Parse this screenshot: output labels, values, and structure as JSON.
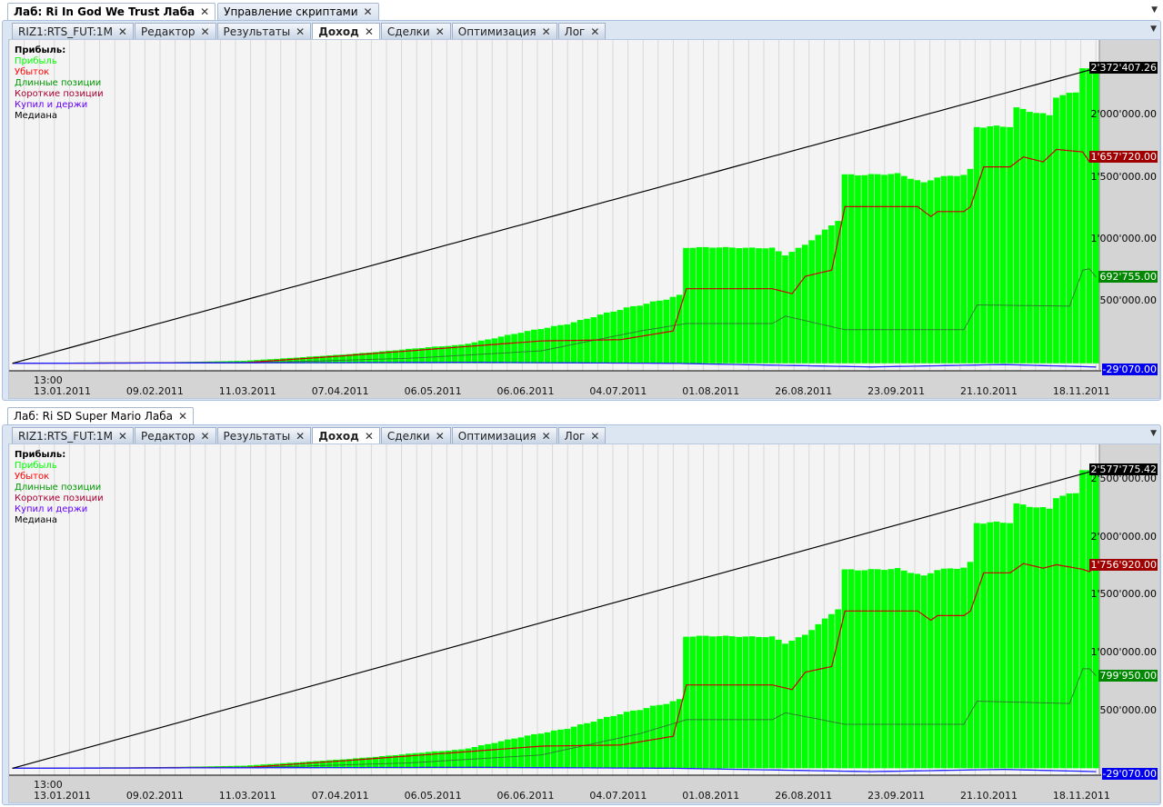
{
  "top_window": {
    "tabs": [
      {
        "label": "Лаб: Ri In God We Trust Лаба",
        "active": true
      },
      {
        "label": "Управление скриптами",
        "active": false
      }
    ]
  },
  "bottom_window": {
    "tabs": [
      {
        "label": "Лаб: Ri SD Super Mario Лаба",
        "active": true
      }
    ]
  },
  "inner_tabs": [
    {
      "label": "RIZ1:RTS_FUT:1M"
    },
    {
      "label": "Редактор"
    },
    {
      "label": "Результаты"
    },
    {
      "label": "Доход",
      "active": true
    },
    {
      "label": "Сделки"
    },
    {
      "label": "Оптимизация"
    },
    {
      "label": "Лог"
    }
  ],
  "legend": {
    "title": "Прибыль:",
    "items": [
      {
        "label": "Прибыль",
        "color": "#00ff00"
      },
      {
        "label": "Убыток",
        "color": "#ff0000"
      },
      {
        "label": "Длинные позиции",
        "color": "#009900"
      },
      {
        "label": "Короткие позиции",
        "color": "#aa0033"
      },
      {
        "label": "Купил и держи",
        "color": "#6600ff"
      },
      {
        "label": "Медиана",
        "color": "#000000"
      }
    ]
  },
  "x_time_label": "13:00",
  "x_dates": [
    "13.01.2011",
    "09.02.2011",
    "11.03.2011",
    "07.04.2011",
    "06.05.2011",
    "06.06.2011",
    "04.07.2011",
    "01.08.2011",
    "26.08.2011",
    "23.09.2011",
    "21.10.2011",
    "18.11.2011"
  ],
  "chart_data": [
    {
      "type": "bar",
      "title": "Ri In God We Trust Лаба — Доход",
      "bars": 165,
      "ylim": [
        -60000,
        2600000
      ],
      "yticks": [
        "500'000.00",
        "1'000'000.00",
        "1'500'000.00",
        "2'000'000.00"
      ],
      "ytick_values": [
        500000,
        1000000,
        1500000,
        2000000
      ],
      "last_labels": {
        "profit": "2'372'407.26",
        "short": "1'657'720.00",
        "long": "692'755.00",
        "buyhold": "-29'070.00"
      },
      "profit": [
        [
          0,
          0
        ],
        [
          20,
          5000
        ],
        [
          35,
          20000
        ],
        [
          50,
          70000
        ],
        [
          68,
          150000
        ],
        [
          84,
          320000
        ],
        [
          101,
          550000
        ],
        [
          102,
          930000
        ],
        [
          115,
          930000
        ],
        [
          117,
          870000
        ],
        [
          120,
          950000
        ],
        [
          125,
          1150000
        ],
        [
          126,
          1520000
        ],
        [
          134,
          1520000
        ],
        [
          138,
          1450000
        ],
        [
          140,
          1500000
        ],
        [
          144,
          1520000
        ],
        [
          145,
          1560000
        ],
        [
          146,
          1900000
        ],
        [
          151,
          1900000
        ],
        [
          152,
          2050000
        ],
        [
          157,
          2000000
        ],
        [
          158,
          2150000
        ],
        [
          161,
          2180000
        ],
        [
          162,
          2370000
        ],
        [
          164,
          2372407
        ]
      ],
      "short": [
        [
          0,
          0
        ],
        [
          35,
          5000
        ],
        [
          50,
          60000
        ],
        [
          65,
          120000
        ],
        [
          80,
          180000
        ],
        [
          92,
          190000
        ],
        [
          100,
          260000
        ],
        [
          102,
          600000
        ],
        [
          115,
          600000
        ],
        [
          118,
          560000
        ],
        [
          120,
          700000
        ],
        [
          124,
          750000
        ],
        [
          126,
          1260000
        ],
        [
          137,
          1260000
        ],
        [
          139,
          1180000
        ],
        [
          140,
          1220000
        ],
        [
          144,
          1220000
        ],
        [
          145,
          1260000
        ],
        [
          147,
          1580000
        ],
        [
          151,
          1580000
        ],
        [
          153,
          1660000
        ],
        [
          156,
          1620000
        ],
        [
          158,
          1720000
        ],
        [
          162,
          1700000
        ],
        [
          163,
          1620000
        ],
        [
          164,
          1657720
        ]
      ],
      "long": [
        [
          0,
          0
        ],
        [
          40,
          10000
        ],
        [
          60,
          40000
        ],
        [
          80,
          100000
        ],
        [
          95,
          260000
        ],
        [
          102,
          320000
        ],
        [
          115,
          320000
        ],
        [
          117,
          380000
        ],
        [
          126,
          270000
        ],
        [
          144,
          270000
        ],
        [
          146,
          470000
        ],
        [
          160,
          460000
        ],
        [
          162,
          750000
        ],
        [
          163,
          760000
        ],
        [
          164,
          692755
        ]
      ],
      "buyhold": [
        [
          0,
          0
        ],
        [
          40,
          5000
        ],
        [
          70,
          8000
        ],
        [
          100,
          0
        ],
        [
          105,
          -5000
        ],
        [
          130,
          -29070
        ],
        [
          150,
          -10000
        ],
        [
          164,
          -29070
        ]
      ],
      "median": [
        [
          0,
          0
        ],
        [
          164,
          2372407
        ]
      ]
    },
    {
      "type": "bar",
      "title": "Ri SD Super Mario Лаба — Доход",
      "bars": 165,
      "ylim": [
        -60000,
        2800000
      ],
      "yticks": [
        "500'000.00",
        "1'000'000.00",
        "1'500'000.00",
        "2'000'000.00",
        "2'500'000.00"
      ],
      "ytick_values": [
        500000,
        1000000,
        1500000,
        2000000,
        2500000
      ],
      "last_labels": {
        "profit": "2'577'775.42",
        "short": "1'756'920.00",
        "long": "799'950.00",
        "buyhold": "-29'070.00"
      },
      "profit": [
        [
          0,
          0
        ],
        [
          20,
          5000
        ],
        [
          35,
          22000
        ],
        [
          50,
          76000
        ],
        [
          68,
          163000
        ],
        [
          84,
          348000
        ],
        [
          101,
          597000
        ],
        [
          102,
          1140000
        ],
        [
          115,
          1140000
        ],
        [
          117,
          1080000
        ],
        [
          120,
          1150000
        ],
        [
          125,
          1380000
        ],
        [
          126,
          1720000
        ],
        [
          134,
          1720000
        ],
        [
          138,
          1660000
        ],
        [
          140,
          1720000
        ],
        [
          144,
          1740000
        ],
        [
          145,
          1780000
        ],
        [
          146,
          2120000
        ],
        [
          151,
          2120000
        ],
        [
          152,
          2280000
        ],
        [
          157,
          2250000
        ],
        [
          158,
          2350000
        ],
        [
          161,
          2380000
        ],
        [
          162,
          2577000
        ],
        [
          164,
          2577775
        ]
      ],
      "short": [
        [
          0,
          0
        ],
        [
          35,
          5000
        ],
        [
          50,
          64000
        ],
        [
          65,
          127000
        ],
        [
          80,
          191000
        ],
        [
          92,
          201000
        ],
        [
          100,
          276000
        ],
        [
          102,
          720000
        ],
        [
          115,
          720000
        ],
        [
          118,
          680000
        ],
        [
          120,
          830000
        ],
        [
          124,
          880000
        ],
        [
          126,
          1360000
        ],
        [
          137,
          1360000
        ],
        [
          139,
          1280000
        ],
        [
          140,
          1320000
        ],
        [
          144,
          1320000
        ],
        [
          145,
          1360000
        ],
        [
          147,
          1690000
        ],
        [
          151,
          1690000
        ],
        [
          153,
          1770000
        ],
        [
          156,
          1730000
        ],
        [
          158,
          1760000
        ],
        [
          162,
          1720000
        ],
        [
          163,
          1700000
        ],
        [
          164,
          1756920
        ]
      ],
      "long": [
        [
          0,
          0
        ],
        [
          40,
          12000
        ],
        [
          60,
          46000
        ],
        [
          80,
          115000
        ],
        [
          95,
          300000
        ],
        [
          102,
          420000
        ],
        [
          115,
          420000
        ],
        [
          117,
          480000
        ],
        [
          126,
          380000
        ],
        [
          144,
          380000
        ],
        [
          146,
          580000
        ],
        [
          160,
          560000
        ],
        [
          162,
          860000
        ],
        [
          163,
          860000
        ],
        [
          164,
          799950
        ]
      ],
      "buyhold": [
        [
          0,
          0
        ],
        [
          40,
          5000
        ],
        [
          70,
          8000
        ],
        [
          100,
          0
        ],
        [
          105,
          -5000
        ],
        [
          130,
          -29070
        ],
        [
          150,
          -10000
        ],
        [
          164,
          -29070
        ]
      ],
      "median": [
        [
          0,
          0
        ],
        [
          164,
          2577775
        ]
      ]
    }
  ]
}
